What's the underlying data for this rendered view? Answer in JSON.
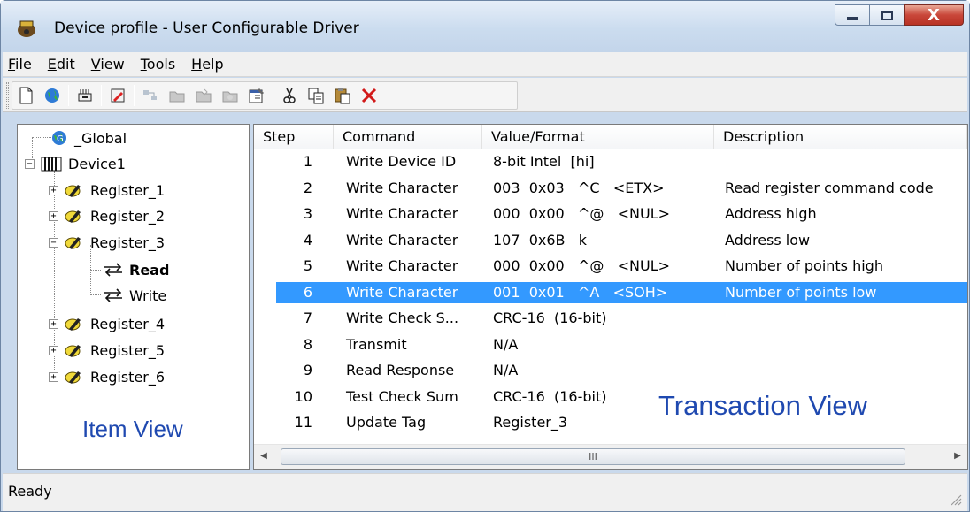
{
  "window": {
    "title": "Device profile - User Configurable Driver",
    "close_glyph": "X"
  },
  "menu": [
    "File",
    "Edit",
    "View",
    "Tools",
    "Help"
  ],
  "menu_mnemonics": [
    "F",
    "E",
    "V",
    "T",
    "H"
  ],
  "toolbar": {
    "icons": [
      "new-icon",
      "globe-icon",
      "device-icon",
      "register-icon",
      "read-icon",
      "folder-read-icon",
      "folder-write-icon",
      "folder-icon",
      "properties-icon",
      "cut-icon",
      "copy-icon",
      "paste-icon",
      "delete-icon"
    ]
  },
  "tree": {
    "global": "_Global",
    "device": "Device1",
    "registers": [
      "Register_1",
      "Register_2",
      "Register_3",
      "Register_4",
      "Register_5",
      "Register_6"
    ],
    "transactions": [
      "Read",
      "Write"
    ],
    "expanders": {
      "collapsed": "+",
      "expanded": "−"
    }
  },
  "labels": {
    "item_view": "Item View",
    "transaction_view": "Transaction View"
  },
  "table": {
    "columns": [
      "Step",
      "Command",
      "Value/Format",
      "Description"
    ],
    "rows": [
      {
        "step": "1",
        "command": "Write Device ID",
        "value": "8-bit Intel  [hi]",
        "description": ""
      },
      {
        "step": "2",
        "command": "Write Character",
        "value": "003  0x03   ^C   <ETX>",
        "description": "Read register command code"
      },
      {
        "step": "3",
        "command": "Write Character",
        "value": "000  0x00   ^@   <NUL>",
        "description": "Address high"
      },
      {
        "step": "4",
        "command": "Write Character",
        "value": "107  0x6B   k",
        "description": "Address low"
      },
      {
        "step": "5",
        "command": "Write Character",
        "value": "000  0x00   ^@   <NUL>",
        "description": "Number of points high"
      },
      {
        "step": "6",
        "command": "Write Character",
        "value": "001  0x01   ^A   <SOH>",
        "description": "Number of points low"
      },
      {
        "step": "7",
        "command": "Write Check S...",
        "value": "CRC-16  (16-bit)",
        "description": ""
      },
      {
        "step": "8",
        "command": "Transmit",
        "value": "N/A",
        "description": ""
      },
      {
        "step": "9",
        "command": "Read Response",
        "value": "N/A",
        "description": ""
      },
      {
        "step": "10",
        "command": "Test Check Sum",
        "value": "CRC-16  (16-bit)",
        "description": ""
      },
      {
        "step": "11",
        "command": "Update Tag",
        "value": "Register_3",
        "description": ""
      }
    ],
    "selected_step": "6"
  },
  "scrollbar": {
    "thumb_glyph": "III",
    "left_glyph": "◀",
    "right_glyph": "▶"
  },
  "status": {
    "text": "Ready"
  },
  "colors": {
    "selection": "#3399ff",
    "annotation": "#1f49b0",
    "close_button": "#c9473a"
  }
}
